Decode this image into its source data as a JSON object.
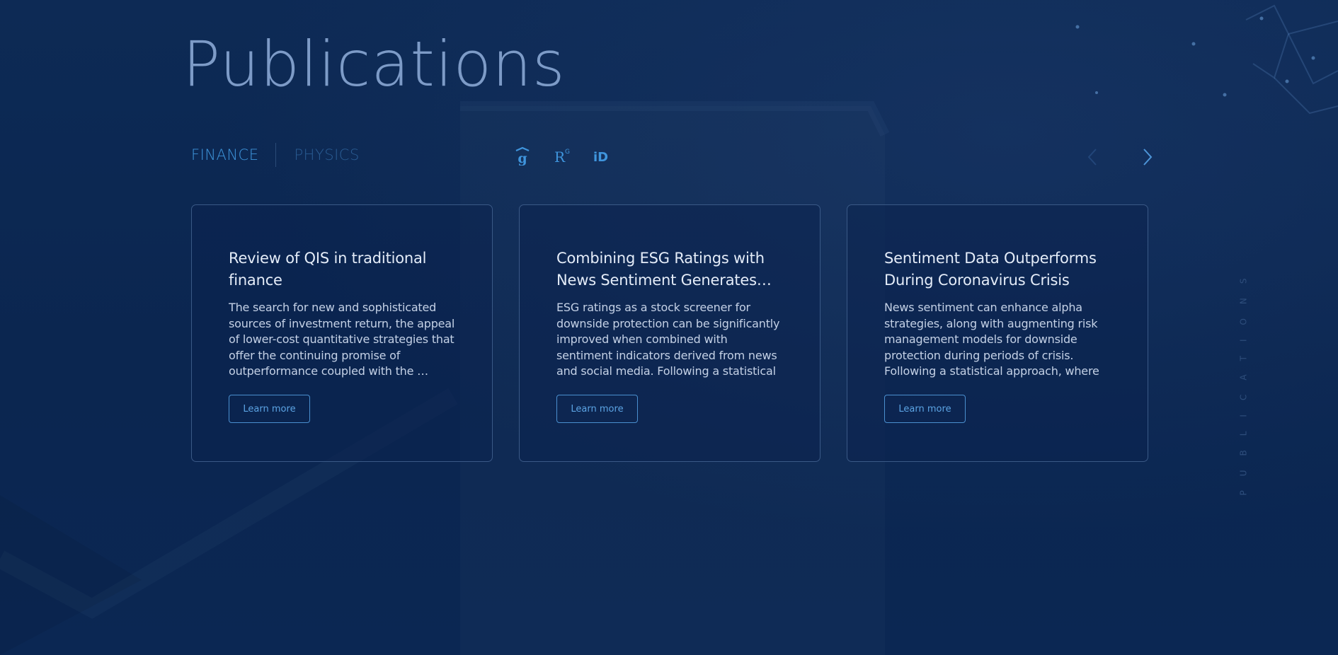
{
  "page": {
    "title": "Publications",
    "side_label": "PUBLICATIONS"
  },
  "tabs": [
    {
      "label": "FINANCE",
      "active": true
    },
    {
      "label": "PHYSICS",
      "active": false
    }
  ],
  "profile_links": [
    {
      "icon": "google-scholar-icon"
    },
    {
      "icon": "researchgate-icon",
      "glyph": "R",
      "sup": "G"
    },
    {
      "icon": "orcid-icon",
      "glyph": "iD"
    }
  ],
  "cards": [
    {
      "title": "Review of QIS in traditional finance",
      "excerpt": "The search for new and sophisticated sources of investment return, the appeal of lower-cost quantitative strategies that offer the continuing promise of outperformance coupled with the …",
      "button_label": "Learn more"
    },
    {
      "title": "Combining ESG Ratings with News Sentiment Generates…",
      "excerpt": "ESG ratings as a stock screener for downside protection can be significantly improved when combined with sentiment indicators derived from news and social media. Following a statistical approach …",
      "button_label": "Learn more"
    },
    {
      "title": "Sentiment Data Outperforms During Coronavirus Crisis",
      "excerpt": "News sentiment can enhance alpha strategies, along with augmenting risk management models for downside protection during periods of crisis. Following a statistical approach, where b…",
      "button_label": "Learn more"
    }
  ],
  "colors": {
    "background": "#0c2650",
    "title": "#7d9bc7",
    "accent": "#3e95dc",
    "tab_inactive": "#2a5c93",
    "card_border": "#3a5986"
  }
}
